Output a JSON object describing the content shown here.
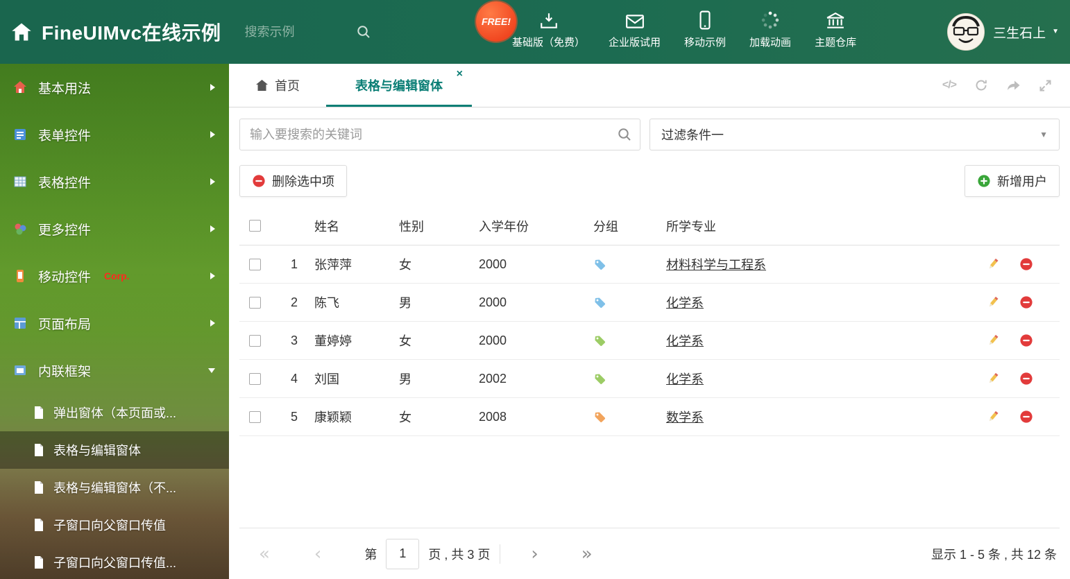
{
  "header": {
    "title": "FineUIMvc在线示例",
    "search_placeholder": "搜索示例",
    "free_badge": "FREE!",
    "nav": [
      {
        "label": "基础版（免费）"
      },
      {
        "label": "企业版试用"
      },
      {
        "label": "移动示例"
      },
      {
        "label": "加载动画"
      },
      {
        "label": "主题仓库"
      }
    ],
    "user_name": "三生石上"
  },
  "sidebar": {
    "items": [
      {
        "label": "基本用法"
      },
      {
        "label": "表单控件"
      },
      {
        "label": "表格控件"
      },
      {
        "label": "更多控件"
      },
      {
        "label": "移动控件",
        "badge": "Corp."
      },
      {
        "label": "页面布局"
      },
      {
        "label": "内联框架"
      }
    ],
    "subitems": [
      {
        "label": "弹出窗体（本页面或..."
      },
      {
        "label": "表格与编辑窗体"
      },
      {
        "label": "表格与编辑窗体（不..."
      },
      {
        "label": "子窗口向父窗口传值"
      },
      {
        "label": "子窗口向父窗口传值..."
      }
    ]
  },
  "tabs": {
    "home_label": "首页",
    "active_label": "表格与编辑窗体"
  },
  "filter_bar": {
    "search_placeholder": "输入要搜索的关键词",
    "filter_selected": "过滤条件一"
  },
  "toolbar": {
    "delete_label": "删除选中项",
    "add_label": "新增用户"
  },
  "table": {
    "columns": {
      "name": "姓名",
      "gender": "性别",
      "year": "入学年份",
      "group": "分组",
      "major": "所学专业"
    },
    "rows": [
      {
        "num": "1",
        "name": "张萍萍",
        "gender": "女",
        "year": "2000",
        "tag_color": "#7fc0e8",
        "major": "材料科学与工程系"
      },
      {
        "num": "2",
        "name": "陈飞",
        "gender": "男",
        "year": "2000",
        "tag_color": "#7fc0e8",
        "major": "化学系"
      },
      {
        "num": "3",
        "name": "董婷婷",
        "gender": "女",
        "year": "2000",
        "tag_color": "#9ccc65",
        "major": "化学系"
      },
      {
        "num": "4",
        "name": "刘国",
        "gender": "男",
        "year": "2002",
        "tag_color": "#9ccc65",
        "major": "化学系"
      },
      {
        "num": "5",
        "name": "康颖颖",
        "gender": "女",
        "year": "2008",
        "tag_color": "#f2a45c",
        "major": "数学系"
      }
    ]
  },
  "pagination": {
    "page_prefix": "第",
    "page_value": "1",
    "page_suffix": "页 , 共 3 页",
    "summary": "显示 1 - 5 条 , 共 12 条"
  },
  "icons": {
    "close": "×",
    "code": "</>",
    "caret_down": "▼",
    "pg_first": "«",
    "pg_prev": "‹",
    "pg_next": "›",
    "pg_last": "»"
  },
  "colors": {
    "accent_teal": "#0a7e75",
    "header_green": "#1b6750",
    "danger_red": "#e23b3b",
    "success_green": "#3aa63a"
  }
}
